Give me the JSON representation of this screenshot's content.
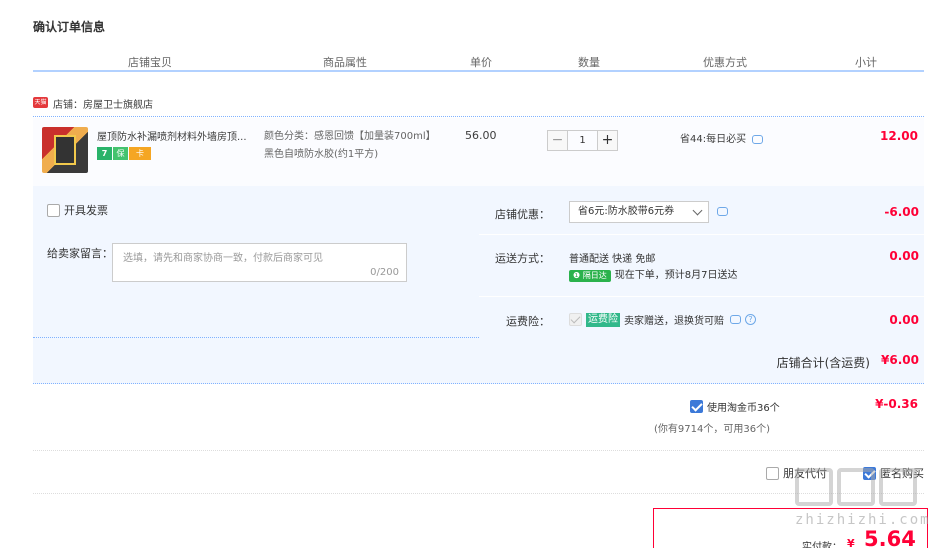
{
  "page": {
    "title": "确认订单信息"
  },
  "columns": [
    "店铺宝贝",
    "商品属性",
    "单价",
    "数量",
    "优惠方式",
    "小计"
  ],
  "shop": {
    "badge": "天猫",
    "label": "店铺：房屋卫士旗舰店"
  },
  "item": {
    "name": "屋顶防水补漏喷剂材料外墙房顶...",
    "icon_badges": [
      "7",
      "保",
      "卡"
    ],
    "attributes": "颜色分类：感恩回馈【加量装700ml】黑色自喷防水胶(约1平方)",
    "price": "56.00",
    "quantity": "1",
    "minus": "−",
    "plus": "+",
    "promo": "省44:每日必买",
    "subtotal": "12.00"
  },
  "invoice": {
    "label": "开具发票"
  },
  "message": {
    "label": "给卖家留言：",
    "placeholder": "选填，请先和商家协商一致，付款后商家可见",
    "count": "0/200"
  },
  "store_discount": {
    "label": "店铺优惠：",
    "selected": "省6元:防水胶带6元券",
    "amount": "-6.00"
  },
  "shipping": {
    "label": "运送方式：",
    "method": "普通配送 快递 免邮",
    "tag": "❶ 隔日达",
    "eta": "现在下单，预计8月7日送达",
    "amount": "0.00"
  },
  "insurance": {
    "label": "运费险：",
    "tag": "运费险",
    "text": "卖家赠送，退换货可赔",
    "amount": "0.00"
  },
  "shop_total": {
    "label": "店铺合计(含运费)",
    "value": "¥6.00"
  },
  "coins": {
    "label": "使用淘金币36个",
    "sub": "(你有9714个，可用36个)",
    "amount": "¥-0.36"
  },
  "options": {
    "friend_pay": "朋友代付",
    "anonymous": "匿名购买"
  },
  "payment": {
    "label": "实付款：",
    "currency": "¥",
    "value": "5.64"
  },
  "watermark": {
    "text": "zhizhizhi.com"
  }
}
